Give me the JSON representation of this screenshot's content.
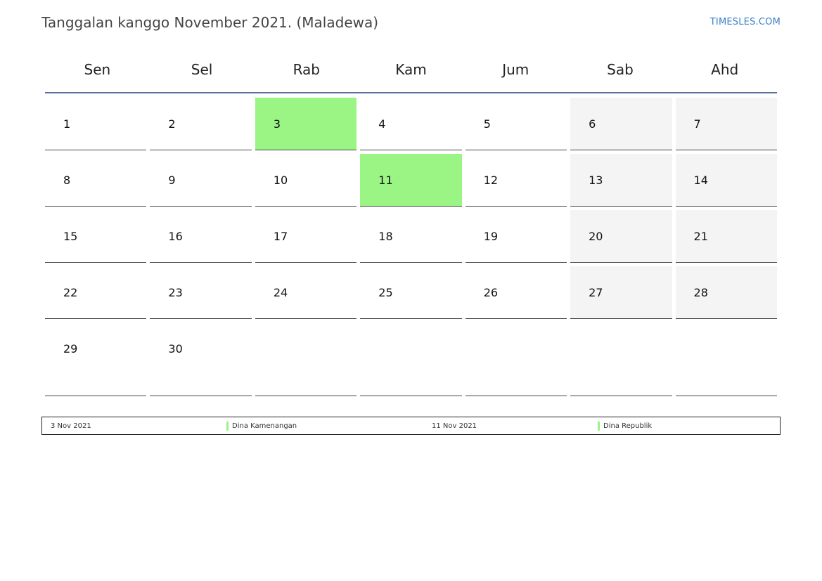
{
  "title": "Tanggalan kanggo November 2021. (Maladewa)",
  "site_link": "TIMESLES.COM",
  "colors": {
    "holiday": "#9af585",
    "weekend": "#f4f4f4",
    "header_rule": "#5a7399",
    "link": "#3a7ec6"
  },
  "weekdays": [
    "Sen",
    "Sel",
    "Rab",
    "Kam",
    "Jum",
    "Sab",
    "Ahd"
  ],
  "weeks": [
    [
      "1",
      "2",
      "3",
      "4",
      "5",
      "6",
      "7"
    ],
    [
      "8",
      "9",
      "10",
      "11",
      "12",
      "13",
      "14"
    ],
    [
      "15",
      "16",
      "17",
      "18",
      "19",
      "20",
      "21"
    ],
    [
      "22",
      "23",
      "24",
      "25",
      "26",
      "27",
      "28"
    ],
    [
      "29",
      "30",
      "",
      "",
      "",
      "",
      ""
    ]
  ],
  "holidays": [
    {
      "date": "3 Nov 2021",
      "name": "Dina Kamenangan"
    },
    {
      "date": "11 Nov 2021",
      "name": "Dina Republik"
    }
  ]
}
